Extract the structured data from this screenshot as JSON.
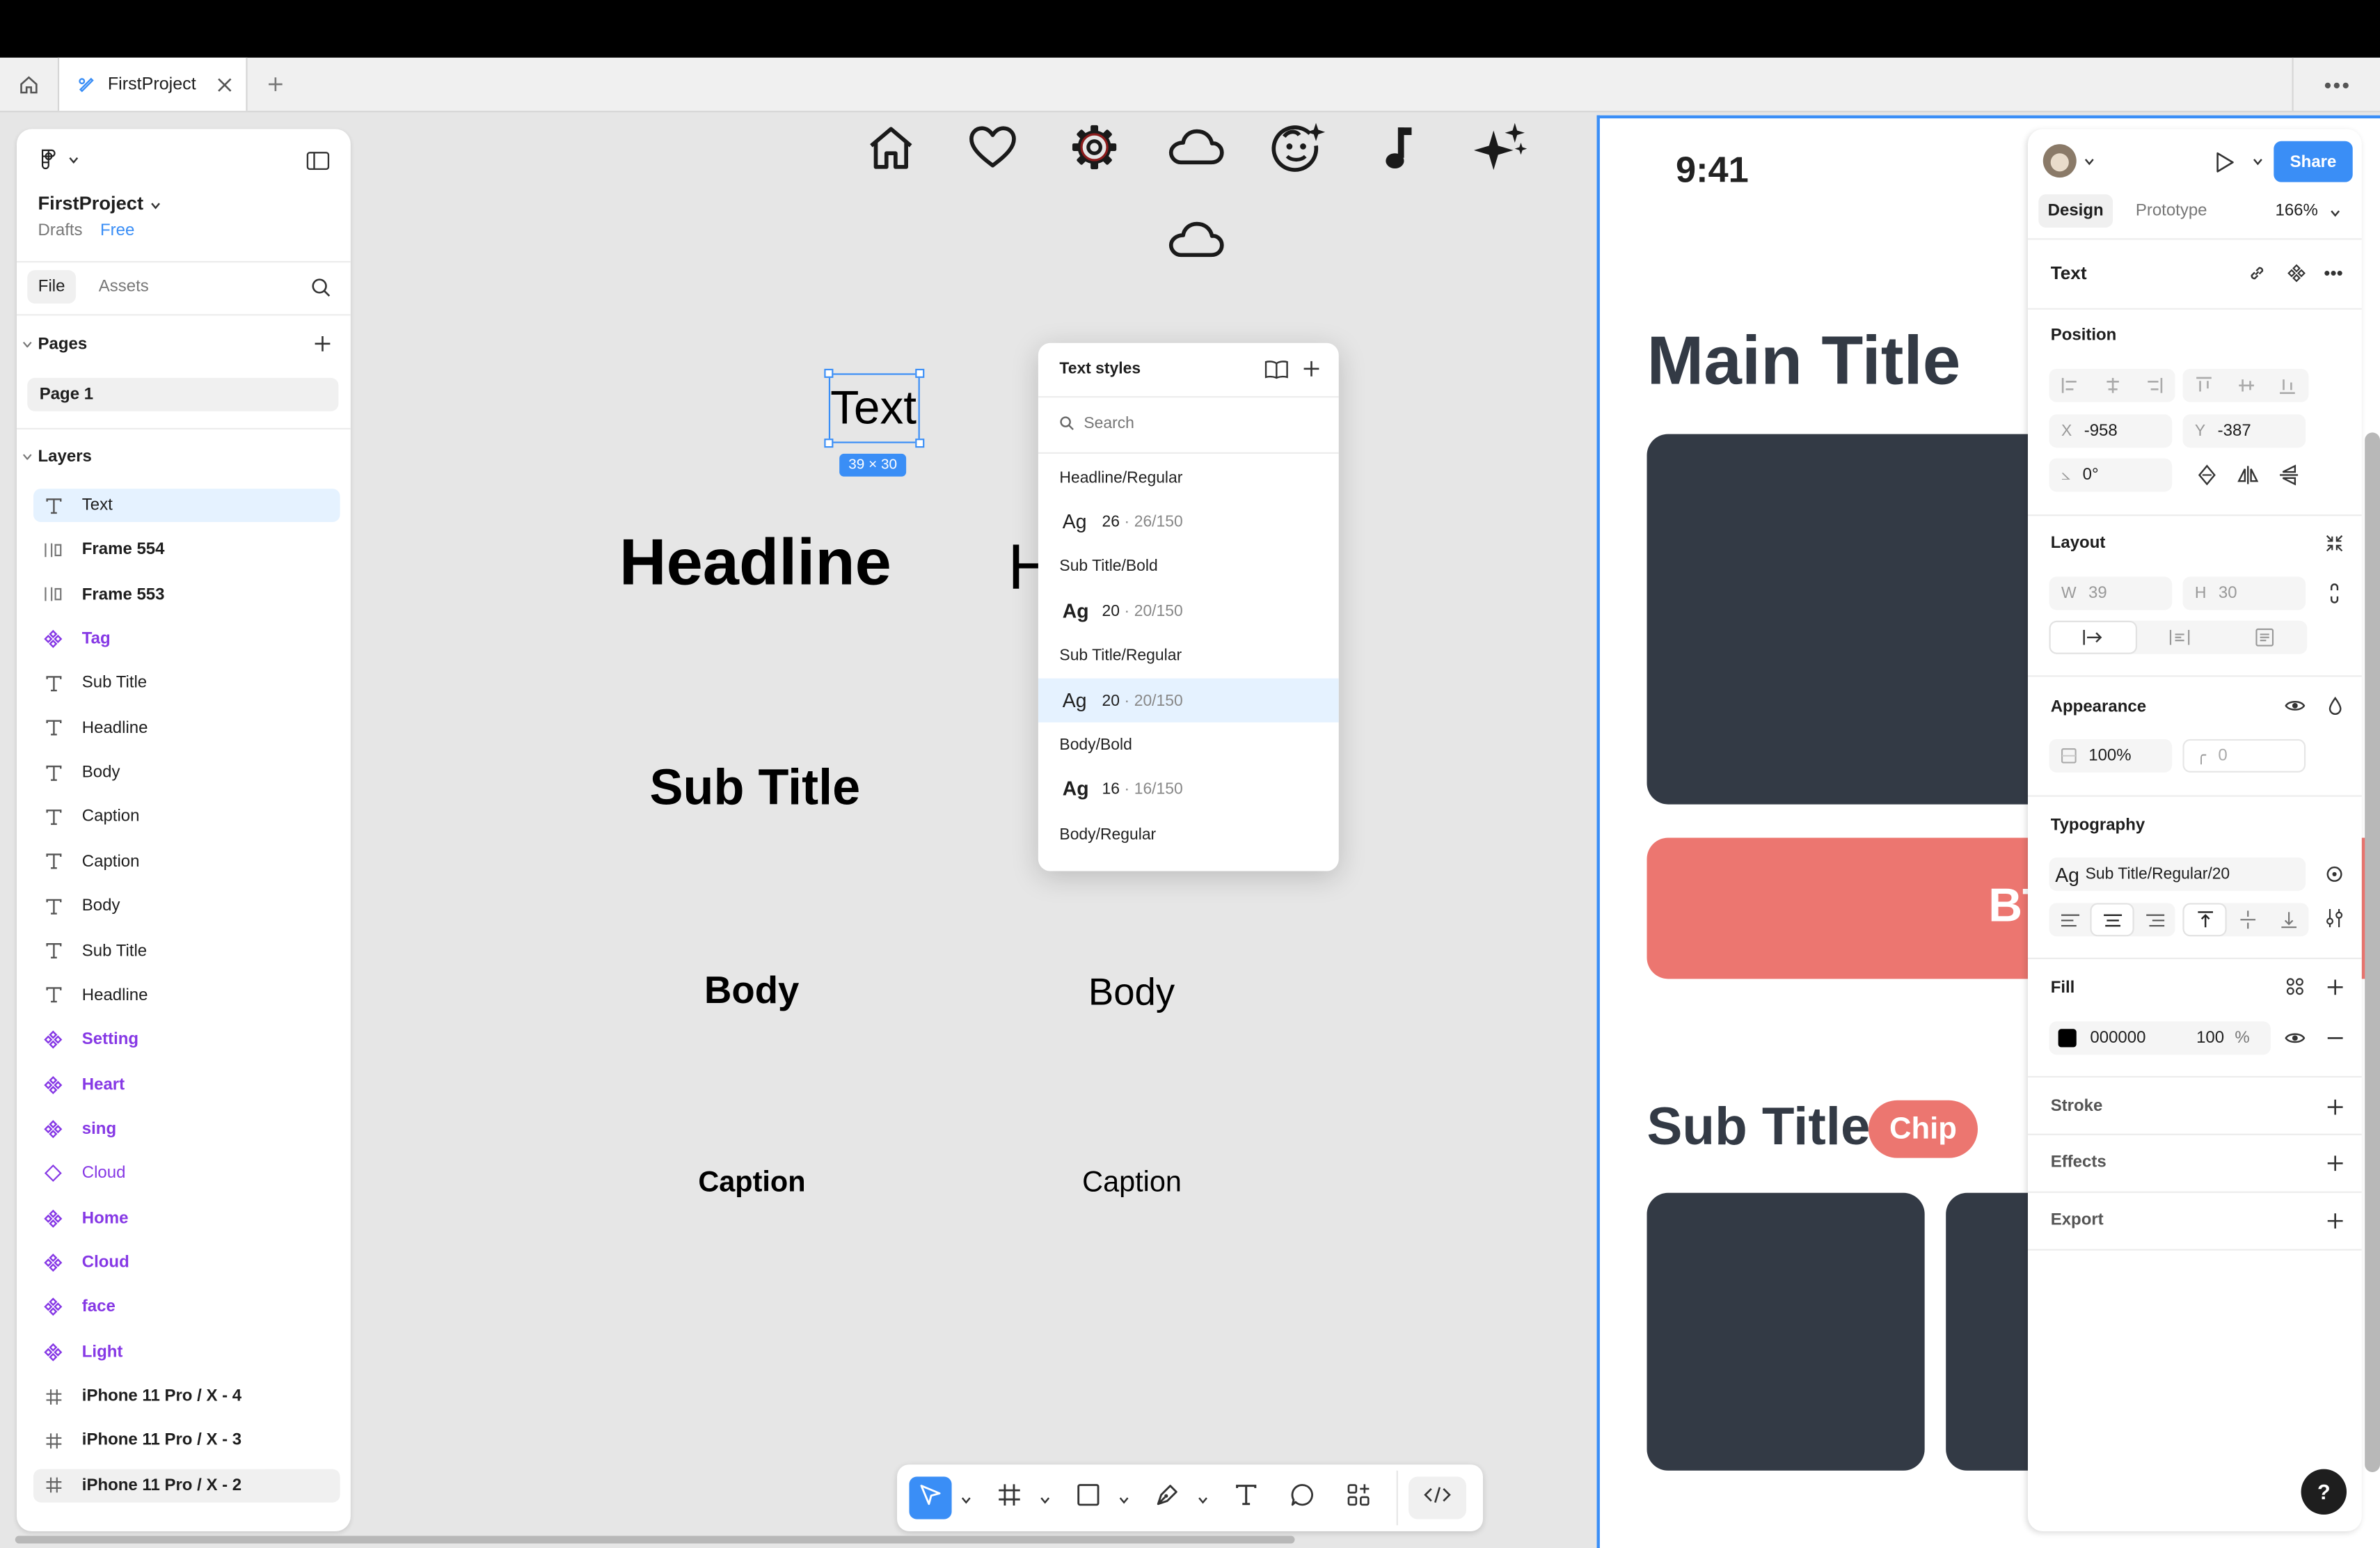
{
  "tabs": {
    "home_label": "",
    "file_tab": "FirstProject"
  },
  "left_panel": {
    "project_name": "FirstProject",
    "location": "Drafts",
    "plan_badge": "Free",
    "tab_file": "File",
    "tab_assets": "Assets",
    "pages_heading": "Pages",
    "pages": [
      "Page 1"
    ],
    "layers_heading": "Layers",
    "layers": [
      {
        "name": "Text",
        "kind": "text"
      },
      {
        "name": "Frame 554",
        "kind": "frame"
      },
      {
        "name": "Frame 553",
        "kind": "frame"
      },
      {
        "name": "Tag",
        "kind": "component"
      },
      {
        "name": "Sub Title",
        "kind": "text"
      },
      {
        "name": "Headline",
        "kind": "text"
      },
      {
        "name": "Body",
        "kind": "text"
      },
      {
        "name": "Caption",
        "kind": "text"
      },
      {
        "name": "Caption",
        "kind": "text"
      },
      {
        "name": "Body",
        "kind": "text"
      },
      {
        "name": "Sub Title",
        "kind": "text"
      },
      {
        "name": "Headline",
        "kind": "text"
      },
      {
        "name": "Setting",
        "kind": "component"
      },
      {
        "name": "Heart",
        "kind": "component"
      },
      {
        "name": "sing",
        "kind": "component"
      },
      {
        "name": "Cloud",
        "kind": "instance"
      },
      {
        "name": "Home",
        "kind": "component"
      },
      {
        "name": "Cloud",
        "kind": "component"
      },
      {
        "name": "face",
        "kind": "component"
      },
      {
        "name": "Light",
        "kind": "component"
      },
      {
        "name": "iPhone 11 Pro / X - 4",
        "kind": "board"
      },
      {
        "name": "iPhone 11 Pro / X - 3",
        "kind": "board"
      },
      {
        "name": "iPhone 11 Pro / X - 2",
        "kind": "board"
      }
    ]
  },
  "canvas": {
    "selected_text": "Text",
    "selection_size": "39 × 30",
    "headline": "Headline",
    "headline_partial": "H",
    "subtitle": "Sub Title",
    "body_bold": "Body",
    "body_regular": "Body",
    "caption_bold": "Caption",
    "caption_regular": "Caption",
    "icons": [
      "home-icon",
      "heart-icon",
      "settings-icon",
      "cloud-icon",
      "face-icon",
      "music-note-icon",
      "sparkle-icon",
      "cloud-icon"
    ]
  },
  "text_styles_popover": {
    "title": "Text styles",
    "search_placeholder": "Search",
    "groups": [
      {
        "name": "Headline/Regular",
        "sample": "Ag",
        "size": "26",
        "spec": "26/150"
      },
      {
        "name": "Sub Title/Bold",
        "sample": "Ag",
        "size": "20",
        "spec": "20/150"
      },
      {
        "name": "Sub Title/Regular",
        "sample": "Ag",
        "size": "20",
        "spec": "20/150"
      },
      {
        "name": "Body/Bold",
        "sample": "Ag",
        "size": "16",
        "spec": "16/150"
      },
      {
        "name": "Body/Regular",
        "sample": "",
        "size": "",
        "spec": ""
      }
    ],
    "separator": "·"
  },
  "phone": {
    "time": "9:41",
    "main_title": "Main Title",
    "button_partial": "BT",
    "sub_title": "Sub Title",
    "chip": "Chip"
  },
  "right_panel": {
    "share": "Share",
    "tab_design": "Design",
    "tab_prototype": "Prototype",
    "zoom": "166%",
    "selection_type": "Text",
    "position_heading": "Position",
    "x_label": "X",
    "x_value": "-958",
    "y_label": "Y",
    "y_value": "-387",
    "rotation": "0°",
    "layout_heading": "Layout",
    "w_label": "W",
    "w_value": "39",
    "h_label": "H",
    "h_value": "30",
    "appearance_heading": "Appearance",
    "opacity": "100%",
    "radius": "0",
    "typography_heading": "Typography",
    "text_style_sample": "Ag",
    "text_style": "Sub Title/Regular/20",
    "fill_heading": "Fill",
    "fill_hex": "000000",
    "fill_opacity": "100",
    "fill_pct": "%",
    "stroke_heading": "Stroke",
    "effects_heading": "Effects",
    "export_heading": "Export",
    "help": "?"
  },
  "colors": {
    "accent": "#3a8ef6",
    "component": "#8638e5",
    "dark_card": "#333a45",
    "coral": "#ec7670"
  }
}
